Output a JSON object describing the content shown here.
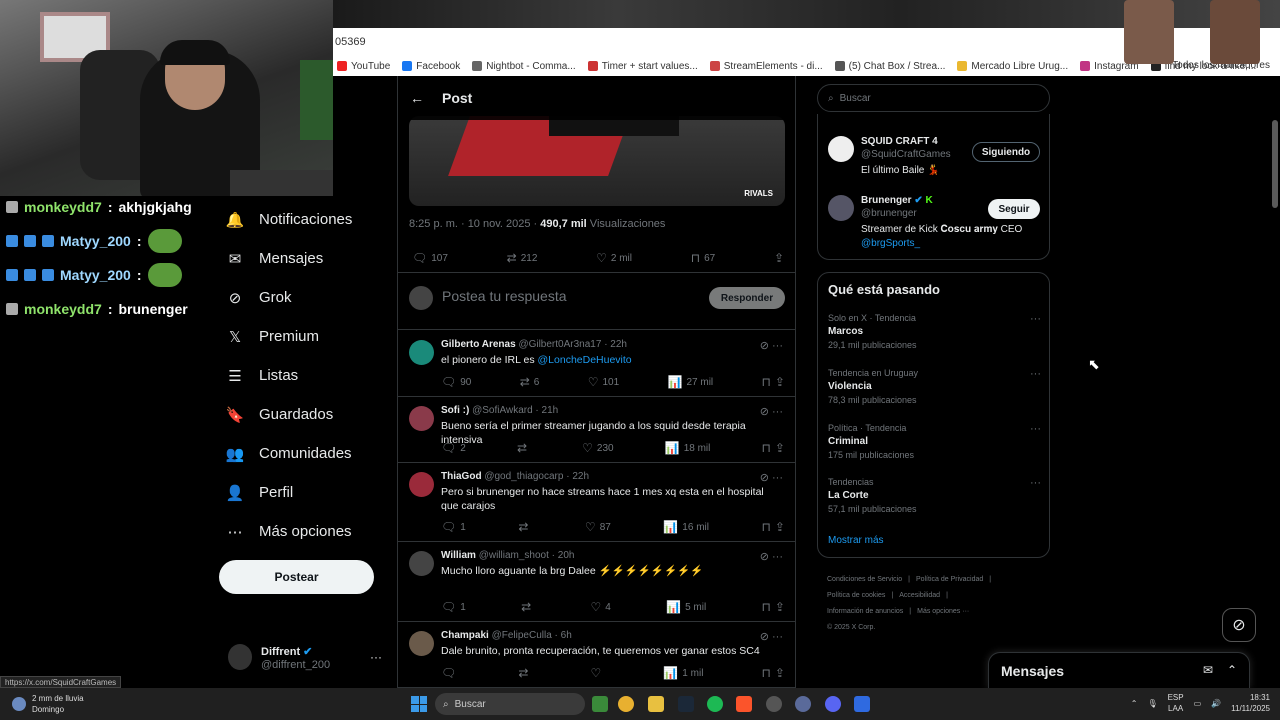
{
  "browser": {
    "url_fragment": "05369",
    "bookmarks": [
      "YouTube",
      "Facebook",
      "Nightbot - Comma...",
      "Timer + start values...",
      "StreamElements - di...",
      "(5) Chat Box / Strea...",
      "Mercado Libre Urug...",
      "Instagram",
      "find my look-a-like,..."
    ],
    "bookmarks_all": "Todos los marcadores"
  },
  "chat": [
    {
      "user": "monkeydd7",
      "msg": "akhjgkjahg",
      "color": "#8fe36b",
      "badges": false,
      "emote": false
    },
    {
      "user": "Matyy_200",
      "msg": "",
      "color": "#9fd8ff",
      "badges": true,
      "emote": true
    },
    {
      "user": "Matyy_200",
      "msg": "",
      "color": "#9fd8ff",
      "badges": true,
      "emote": true
    },
    {
      "user": "monkeydd7",
      "msg": "brunenger",
      "color": "#8fe36b",
      "badges": false,
      "emote": false
    }
  ],
  "nav": {
    "items": [
      {
        "label": "Notificaciones",
        "icon": "bell-icon"
      },
      {
        "label": "Mensajes",
        "icon": "mail-icon"
      },
      {
        "label": "Grok",
        "icon": "grok-icon"
      },
      {
        "label": "Premium",
        "icon": "x-logo-icon"
      },
      {
        "label": "Listas",
        "icon": "list-icon"
      },
      {
        "label": "Guardados",
        "icon": "bookmark-icon"
      },
      {
        "label": "Comunidades",
        "icon": "communities-icon"
      },
      {
        "label": "Perfil",
        "icon": "person-icon"
      },
      {
        "label": "Más opciones",
        "icon": "more-circle-icon"
      }
    ],
    "post_button": "Postear",
    "account": {
      "name": "Diffrent",
      "handle": "@diffrent_200"
    }
  },
  "post": {
    "header": "Post",
    "media_brand": "RIVALS",
    "timestamp": "8:25 p. m. · 10 nov. 2025 · ",
    "views_count": "490,7 mil",
    "views_label": " Visualizaciones",
    "stats": {
      "replies": "107",
      "reposts": "212",
      "likes": "2 mil",
      "bookmarks": "67"
    },
    "reply_placeholder": "Postea tu respuesta",
    "reply_button": "Responder"
  },
  "replies": [
    {
      "name": "Gilberto Arenas",
      "handle": "@Gilbert0Ar3na17 · 22h",
      "text": "el pionero de IRL es ",
      "mention": "@LoncheDeHuevito",
      "replies": "90",
      "reposts": "6",
      "likes": "101",
      "views": "27 mil",
      "avatar": "#1a8a7a"
    },
    {
      "name": "Sofi :)",
      "handle": "@SofiAwkard · 21h",
      "text": "Bueno sería el primer streamer jugando a los squid desde terapia intensiva",
      "mention": "",
      "replies": "2",
      "reposts": "",
      "likes": "230",
      "views": "18 mil",
      "avatar": "#8a3a4a"
    },
    {
      "name": "ThiaGod",
      "handle": "@god_thiagocarp · 22h",
      "text": "Pero si brunenger no hace streams hace 1 mes xq esta en el hospital que carajos",
      "mention": "",
      "replies": "1",
      "reposts": "",
      "likes": "87",
      "views": "16 mil",
      "avatar": "#9a2a3a"
    },
    {
      "name": "William",
      "handle": "@william_shoot · 20h",
      "text": "Mucho lloro aguante la brg Dalee ⚡⚡⚡⚡⚡⚡⚡⚡",
      "mention": "",
      "replies": "1",
      "reposts": "",
      "likes": "4",
      "views": "5 mil",
      "avatar": "#444"
    },
    {
      "name": "Champaki",
      "handle": "@FelipeCulla · 6h",
      "text": "Dale brunito, pronta recuperación, te queremos ver ganar estos SC4",
      "mention": "",
      "replies": "",
      "reposts": "",
      "likes": "",
      "views": "1 mil",
      "avatar": "#6a5a4a"
    }
  ],
  "right": {
    "search_placeholder": "Buscar",
    "people": [
      {
        "name": "SQUID CRAFT 4",
        "handle": "@SquidCraftGames",
        "bio": "El último Baile 💃",
        "bio_link": "",
        "button": "Siguiendo",
        "avatar": "#eee"
      },
      {
        "name": "Brunenger",
        "handle": "@brunenger",
        "bio": "Streamer de Kick 𝐂𝐨𝐬𝐜𝐮 𝐚𝐫𝐦𝐲 CEO ",
        "bio_link": "@brgSports_",
        "button": "Seguir",
        "avatar": "#556"
      }
    ],
    "trends_title": "Qué está pasando",
    "trends": [
      {
        "context": "Solo en X · Tendencia",
        "name": "Marcos",
        "count": "29,1 mil publicaciones"
      },
      {
        "context": "Tendencia en Uruguay",
        "name": "Violencia",
        "count": "78,3 mil publicaciones"
      },
      {
        "context": "Política · Tendencia",
        "name": "Criminal",
        "count": "175 mil publicaciones"
      },
      {
        "context": "Tendencias",
        "name": "La Corte",
        "count": "57,1 mil publicaciones"
      }
    ],
    "show_more": "Mostrar más",
    "footer": [
      "Condiciones de Servicio",
      "|",
      "Política de Privacidad",
      "|",
      "Política de cookies",
      "|",
      "Accesibilidad",
      "|",
      "Información de anuncios",
      "|",
      "Más opciones ···",
      "© 2025 X Corp."
    ],
    "messages_dock": "Mensajes"
  },
  "status_url": "https://x.com/SquidCraftGames",
  "taskbar": {
    "weather": "2 mm de lluvia",
    "weather_day": "Domingo",
    "search": "Buscar",
    "lang1": "ESP",
    "lang2": "LAA",
    "time": "18:31",
    "date": "11/11/2025"
  }
}
